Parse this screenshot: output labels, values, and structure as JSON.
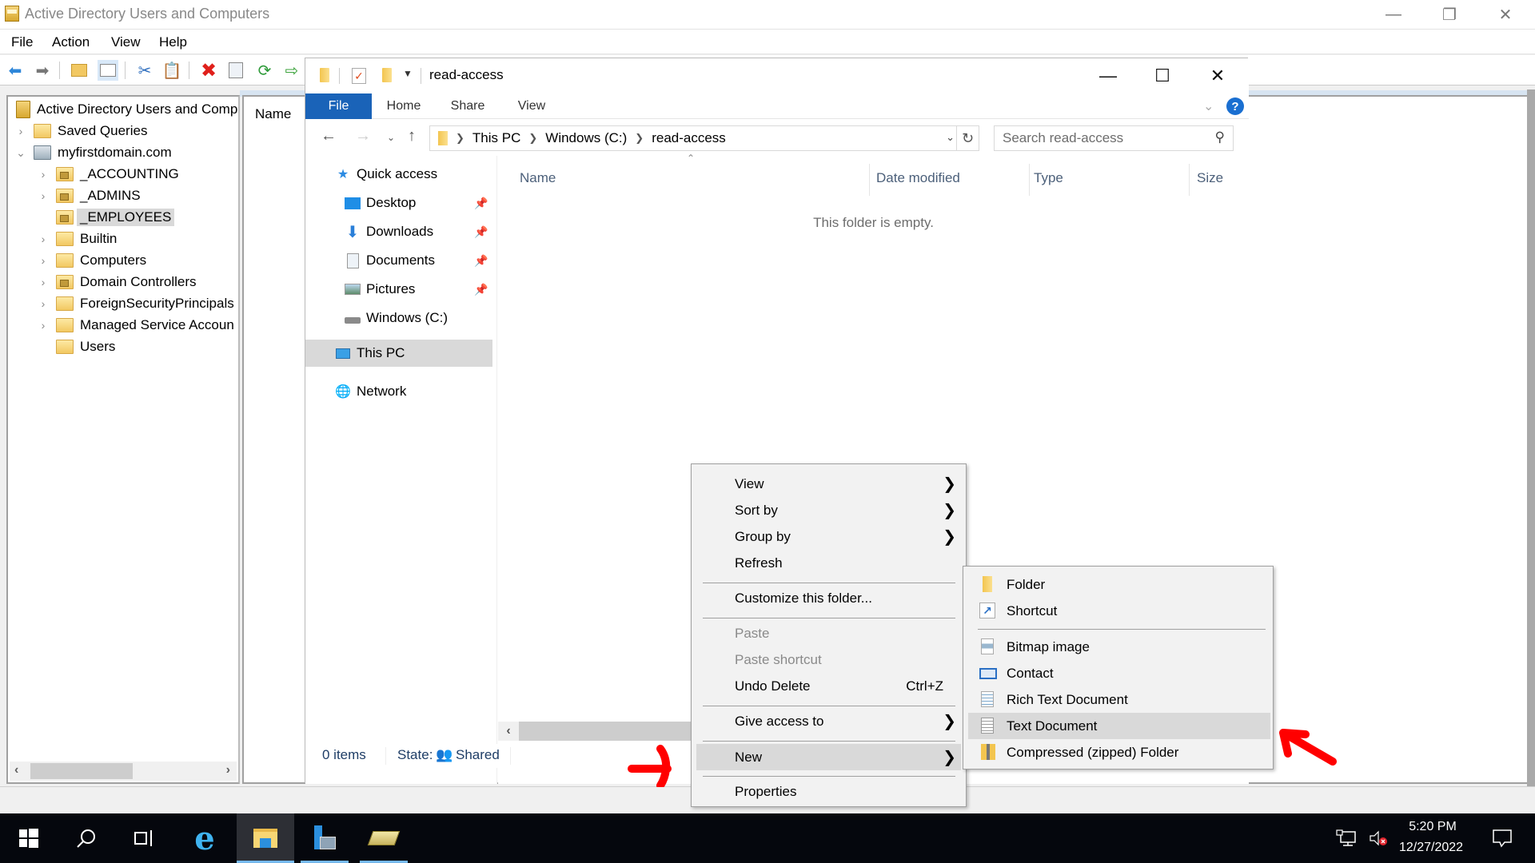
{
  "aduc": {
    "title": "Active Directory Users and Computers",
    "menu": [
      "File",
      "Action",
      "View",
      "Help"
    ],
    "toolbar_icons": [
      "back-icon",
      "forward-icon",
      "up-folder-icon",
      "show-console-tree-icon",
      "cut-icon",
      "paste-icon",
      "delete-icon",
      "properties-icon",
      "refresh-icon",
      "export-list-icon",
      "folder-icon",
      "checkbox-icon",
      "folder-icon"
    ],
    "tree": [
      {
        "label": "Active Directory Users and Comp",
        "level": 0,
        "expander": "",
        "icon": "root"
      },
      {
        "label": "Saved Queries",
        "level": 1,
        "expander": ">",
        "icon": "folder"
      },
      {
        "label": "myfirstdomain.com",
        "level": 1,
        "expander": "v",
        "icon": "domain"
      },
      {
        "label": "_ACCOUNTING",
        "level": 2,
        "expander": ">",
        "icon": "ou"
      },
      {
        "label": "_ADMINS",
        "level": 2,
        "expander": ">",
        "icon": "ou"
      },
      {
        "label": "_EMPLOYEES",
        "level": 2,
        "expander": "",
        "icon": "ou",
        "selected": true
      },
      {
        "label": "Builtin",
        "level": 2,
        "expander": ">",
        "icon": "folder"
      },
      {
        "label": "Computers",
        "level": 2,
        "expander": ">",
        "icon": "folder"
      },
      {
        "label": "Domain Controllers",
        "level": 2,
        "expander": ">",
        "icon": "ou"
      },
      {
        "label": "ForeignSecurityPrincipals",
        "level": 2,
        "expander": ">",
        "icon": "folder"
      },
      {
        "label": "Managed Service Accoun",
        "level": 2,
        "expander": ">",
        "icon": "folder"
      },
      {
        "label": "Users",
        "level": 2,
        "expander": "",
        "icon": "folder"
      }
    ],
    "list_header": "Name"
  },
  "explorer": {
    "title": "read-access",
    "ribbon_tabs": [
      "File",
      "Home",
      "Share",
      "View"
    ],
    "breadcrumb": [
      "This PC",
      "Windows (C:)",
      "read-access"
    ],
    "search_placeholder": "Search read-access",
    "nav_pane": {
      "quick_access": "Quick access",
      "pinned": [
        "Desktop",
        "Downloads",
        "Documents",
        "Pictures"
      ],
      "drive": "Windows (C:)",
      "this_pc": "This PC",
      "network": "Network"
    },
    "columns": [
      "Name",
      "Date modified",
      "Type",
      "Size"
    ],
    "empty_message": "This folder is empty.",
    "status": {
      "items": "0 items",
      "state_label": "State:",
      "state_value": "Shared"
    }
  },
  "context_menu": {
    "items": [
      {
        "label": "View",
        "submenu": true
      },
      {
        "label": "Sort by",
        "submenu": true
      },
      {
        "label": "Group by",
        "submenu": true
      },
      {
        "label": "Refresh"
      },
      {
        "label": "Customize this folder..."
      },
      {
        "label": "Paste",
        "disabled": true
      },
      {
        "label": "Paste shortcut",
        "disabled": true
      },
      {
        "label": "Undo Delete",
        "shortcut": "Ctrl+Z"
      },
      {
        "label": "Give access to",
        "submenu": true
      },
      {
        "label": "New",
        "submenu": true,
        "highlighted": true
      },
      {
        "label": "Properties"
      }
    ]
  },
  "new_submenu": {
    "items": [
      {
        "label": "Folder",
        "icon": "folder-icon"
      },
      {
        "label": "Shortcut",
        "icon": "shortcut-icon"
      },
      {
        "label": "Bitmap image",
        "icon": "bitmap-icon"
      },
      {
        "label": "Contact",
        "icon": "contact-icon"
      },
      {
        "label": "Rich Text Document",
        "icon": "rtf-document-icon"
      },
      {
        "label": "Text Document",
        "icon": "text-document-icon",
        "highlighted": true
      },
      {
        "label": "Compressed (zipped) Folder",
        "icon": "zip-folder-icon"
      }
    ]
  },
  "taskbar": {
    "apps": [
      "start",
      "search",
      "task-view",
      "internet-explorer",
      "file-explorer",
      "server-manager",
      "aduc"
    ],
    "clock_time": "5:20 PM",
    "clock_date": "12/27/2022"
  },
  "colors": {
    "ribbon_file_tab": "#1a63b8",
    "highlight": "#d9d9d9",
    "annotation_red": "#ff0000",
    "taskbar": "#05070d"
  }
}
